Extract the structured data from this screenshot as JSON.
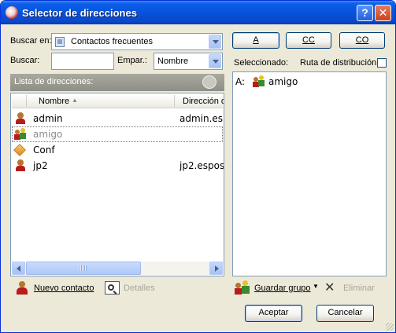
{
  "window": {
    "title": "Selector de direcciones",
    "help_label": "?",
    "close_label": "✕"
  },
  "search": {
    "look_in_label": "Buscar en:",
    "look_in_value": "Contactos frecuentes",
    "search_label": "Buscar:",
    "search_value": "",
    "match_label": "Empar.:",
    "match_value": "Nombre"
  },
  "recipient_buttons": {
    "to": "A",
    "cc": "CC",
    "bcc": "CO"
  },
  "list": {
    "header": "Lista de direcciones:",
    "columns": [
      "Nombre",
      "Dirección de correo"
    ],
    "rows": [
      {
        "name": "admin",
        "email": "admin.es",
        "icon": "user-icon"
      },
      {
        "name": "amigo",
        "email": "",
        "icon": "group-icon"
      },
      {
        "name": "Conf",
        "email": "",
        "icon": "box-icon"
      },
      {
        "name": "jp2",
        "email": "jp2.espos",
        "icon": "user-icon"
      }
    ]
  },
  "selected": {
    "label": "Seleccionado:",
    "route_label": "Ruta de distribución",
    "route_checked": false,
    "items": [
      {
        "prefix": "A:",
        "name": "amigo",
        "icon": "group-icon"
      }
    ]
  },
  "bottom_left": {
    "new_contact": "Nuevo contacto",
    "details": "Detalles"
  },
  "bottom_right": {
    "save_group": "Guardar grupo",
    "delete": "Eliminar"
  },
  "dialog": {
    "ok": "Aceptar",
    "cancel": "Cancelar"
  }
}
